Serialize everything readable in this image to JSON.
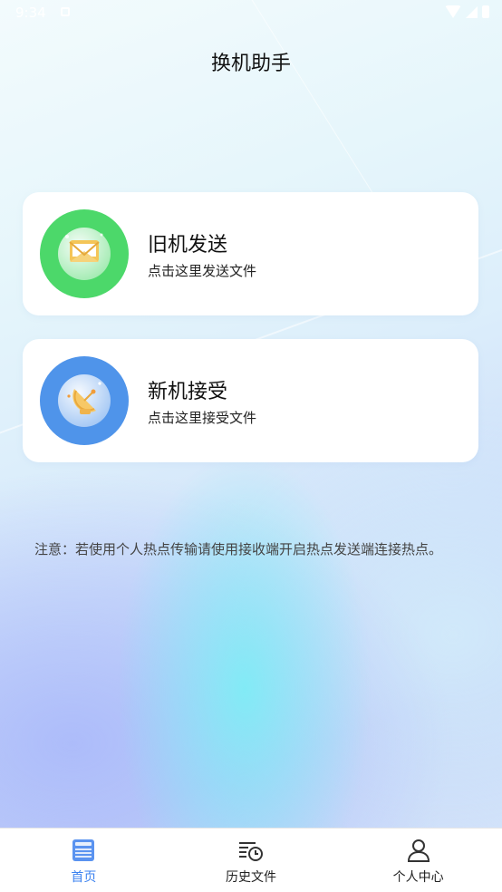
{
  "status_bar": {
    "time": "9:34"
  },
  "header": {
    "title": "换机助手"
  },
  "cards": [
    {
      "title": "旧机发送",
      "subtitle": "点击这里发送文件",
      "icon": "envelope-icon"
    },
    {
      "title": "新机接受",
      "subtitle": "点击这里接受文件",
      "icon": "satellite-dish-icon"
    }
  ],
  "notice": "注意：若使用个人热点传输请使用接收端开启热点发送端连接热点。",
  "tabs": [
    {
      "label": "首页",
      "icon": "home-icon",
      "active": true
    },
    {
      "label": "历史文件",
      "icon": "history-icon",
      "active": false
    },
    {
      "label": "个人中心",
      "icon": "user-icon",
      "active": false
    }
  ],
  "colors": {
    "send_circle": "#4cd86a",
    "recv_circle": "#4f94ea",
    "active_tab": "#3d83f0"
  }
}
